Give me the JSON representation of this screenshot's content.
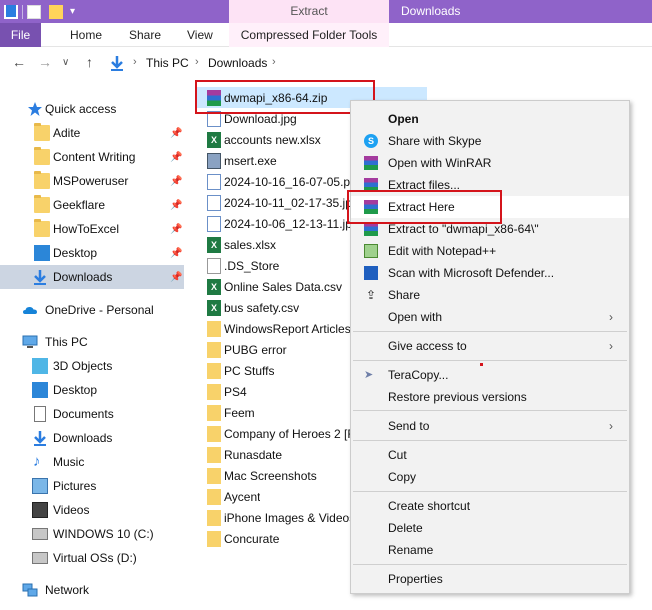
{
  "titlebar": {
    "context_tab": "Extract",
    "window_title": "Downloads"
  },
  "ribbon": {
    "file": "File",
    "home": "Home",
    "share": "Share",
    "view": "View",
    "compressed_folder_tools": "Compressed Folder Tools"
  },
  "address": {
    "crumbs": [
      "This PC",
      "Downloads"
    ]
  },
  "nav_pane": {
    "quick_access": "Quick access",
    "pinned": [
      "Adite",
      "Content Writing",
      "MSPoweruser",
      "Geekflare",
      "HowToExcel",
      "Desktop",
      "Downloads"
    ],
    "onedrive": "OneDrive - Personal",
    "this_pc": "This PC",
    "pc_items": [
      "3D Objects",
      "Desktop",
      "Documents",
      "Downloads",
      "Music",
      "Pictures",
      "Videos",
      "WINDOWS 10 (C:)",
      "Virtual OSs (D:)"
    ],
    "network": "Network"
  },
  "files": [
    {
      "name": "dwmapi_x86-64.zip",
      "type": "zip"
    },
    {
      "name": "Download.jpg",
      "type": "image"
    },
    {
      "name": "accounts new.xlsx",
      "type": "excel"
    },
    {
      "name": "msert.exe",
      "type": "exe"
    },
    {
      "name": "2024-10-16_16-07-05.png",
      "type": "image"
    },
    {
      "name": "2024-10-11_02-17-35.jpg",
      "type": "image"
    },
    {
      "name": "2024-10-06_12-13-11.jpg",
      "type": "image"
    },
    {
      "name": "sales.xlsx",
      "type": "excel"
    },
    {
      "name": ".DS_Store",
      "type": "doc"
    },
    {
      "name": "Online Sales Data.csv",
      "type": "excel"
    },
    {
      "name": "bus safety.csv",
      "type": "excel"
    },
    {
      "name": "WindowsReport Articles",
      "type": "folder"
    },
    {
      "name": "PUBG error",
      "type": "folder"
    },
    {
      "name": "PC Stuffs",
      "type": "folder"
    },
    {
      "name": "PS4",
      "type": "folder"
    },
    {
      "name": "Feem",
      "type": "folder"
    },
    {
      "name": "Company of Heroes 2 [F",
      "type": "folder"
    },
    {
      "name": "Runasdate",
      "type": "folder"
    },
    {
      "name": "Mac Screenshots",
      "type": "folder"
    },
    {
      "name": "Aycent",
      "type": "folder"
    },
    {
      "name": "iPhone Images & Videos",
      "type": "folder"
    },
    {
      "name": "Concurate",
      "type": "folder"
    }
  ],
  "context_menu": {
    "open": "Open",
    "share_skype": "Share with Skype",
    "open_winrar": "Open with WinRAR",
    "extract_files": "Extract files...",
    "extract_here": "Extract Here",
    "extract_to": "Extract to \"dwmapi_x86-64\\\"",
    "edit_notepad": "Edit with Notepad++",
    "scan_defender": "Scan with Microsoft Defender...",
    "share": "Share",
    "open_with": "Open with",
    "give_access": "Give access to",
    "teracopy": "TeraCopy...",
    "restore": "Restore previous versions",
    "send_to": "Send to",
    "cut": "Cut",
    "copy": "Copy",
    "create_shortcut": "Create shortcut",
    "delete": "Delete",
    "rename": "Rename",
    "properties": "Properties"
  }
}
